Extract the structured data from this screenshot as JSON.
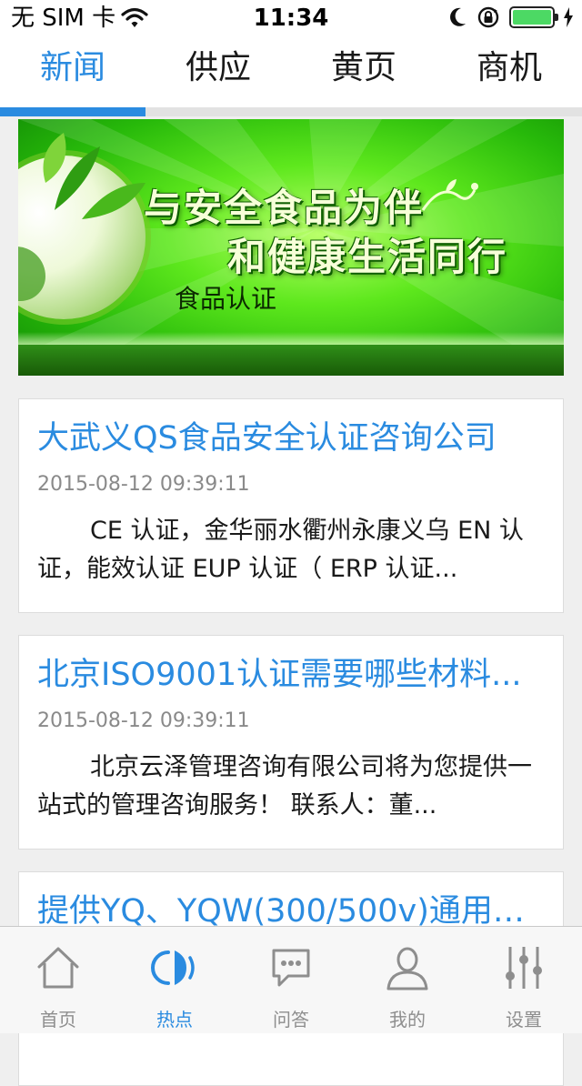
{
  "status_bar": {
    "carrier": "无 SIM 卡",
    "time": "11:34",
    "battery_level": 1.0,
    "battery_color": "#4cd964",
    "icons": [
      "wifi-icon",
      "moon-icon",
      "orientation-lock-icon",
      "battery-icon"
    ]
  },
  "top_tabs": {
    "active_index": 0,
    "accent_color": "#2a8be0",
    "items": [
      {
        "label": "新闻"
      },
      {
        "label": "供应"
      },
      {
        "label": "黄页"
      },
      {
        "label": "商机"
      }
    ]
  },
  "banner": {
    "line1": "与安全食品为伴",
    "line2": "和健康生活同行",
    "line3": "食品认证"
  },
  "news": [
    {
      "title": "大武义QS食品安全认证咨询公司",
      "date": "2015-08-12 09:39:11",
      "summary": "CE 认证，金华丽水衢州永康义乌 EN 认证，能效认证 EUP 认证（ ERP 认证..."
    },
    {
      "title": "北京ISO9001认证需要哪些材料...",
      "date": "2015-08-12 09:39:11",
      "summary": "北京云泽管理咨询有限公司将为您提供一站式的管理咨询服务！ 联系人：董..."
    },
    {
      "title": "提供YQ、YQW(300/500v)通用橡...",
      "date": "",
      "summary": ""
    }
  ],
  "bottom_bar": {
    "active_index": 1,
    "items": [
      {
        "label": "首页",
        "icon": "home-icon"
      },
      {
        "label": "热点",
        "icon": "hotspot-icon"
      },
      {
        "label": "问答",
        "icon": "chat-icon"
      },
      {
        "label": "我的",
        "icon": "user-icon"
      },
      {
        "label": "设置",
        "icon": "settings-sliders-icon"
      }
    ]
  }
}
